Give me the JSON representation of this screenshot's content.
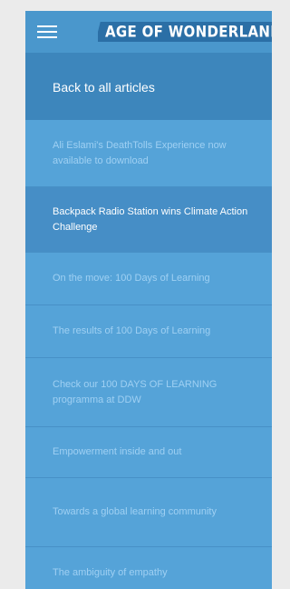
{
  "colors": {
    "page_background": "#ebebeb",
    "panel_background": "#4f9fd4",
    "active_item": "#468ec6",
    "back_row": "#3d86bc",
    "inactive_text": "#9fd0f3",
    "active_text": "#ffffff"
  },
  "header": {
    "menu_icon": "hamburger-menu-icon",
    "logo_text": "AGE OF WONDERLAND"
  },
  "nav": {
    "back_label": "Back to all articles"
  },
  "articles": [
    {
      "title": "Ali Eslami's DeathTolls Experience now available to download",
      "active": false
    },
    {
      "title": "Backpack Radio Station wins Climate Action Challenge",
      "active": true
    },
    {
      "title": "On the move: 100 Days of Learning",
      "active": false
    },
    {
      "title": "The results of 100 Days of Learning",
      "active": false
    },
    {
      "title": "Check our 100 DAYS OF LEARNING programma at DDW",
      "active": false
    },
    {
      "title": "Empowerment inside and out",
      "active": false
    },
    {
      "title": "Towards a global learning community",
      "active": false
    },
    {
      "title": "The ambiguity of empathy",
      "active": false
    }
  ]
}
